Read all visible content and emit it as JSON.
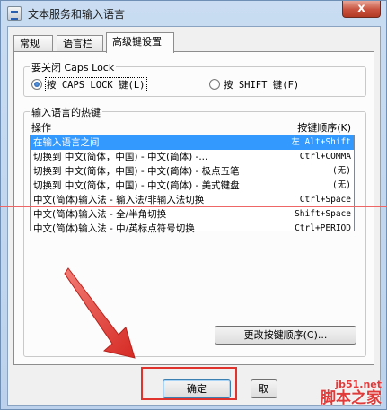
{
  "window": {
    "title": "文本服务和输入语言",
    "close_glyph": "x"
  },
  "tabs": [
    {
      "label": "常规",
      "active": false
    },
    {
      "label": "语言栏",
      "active": false
    },
    {
      "label": "高级键设置",
      "active": true
    }
  ],
  "caps_lock": {
    "group_label": "要关闭 Caps Lock",
    "options": [
      {
        "label": "按 CAPS LOCK 键(L)",
        "checked": true
      },
      {
        "label": "按 SHIFT 键(F)",
        "checked": false
      }
    ]
  },
  "hotkeys": {
    "group_label": "输入语言的热键",
    "col_action": "操作",
    "col_keys": "按键顺序(K)",
    "rows": [
      {
        "action": "在输入语言之间",
        "keys": "左 Alt+Shift",
        "selected": true
      },
      {
        "action": "切换到 中文(简体，中国) - 中文(简体) -...",
        "keys": "Ctrl+COMMA",
        "selected": false
      },
      {
        "action": "切换到 中文(简体，中国) - 中文(简体) - 极点五笔",
        "keys": "(无)",
        "selected": false
      },
      {
        "action": "切换到 中文(简体，中国) - 中文(简体) - 美式键盘",
        "keys": "(无)",
        "selected": false
      },
      {
        "action": "中文(简体)输入法 - 输入法/非输入法切换",
        "keys": "Ctrl+Space",
        "selected": false
      },
      {
        "action": "中文(简体)输入法 - 全/半角切换",
        "keys": "Shift+Space",
        "selected": false
      },
      {
        "action": "中文(简体)输入法 - 中/英标点符号切换",
        "keys": "Ctrl+PERIOD",
        "selected": false
      }
    ],
    "change_button": "更改按键顺序(C)..."
  },
  "footer": {
    "ok_button": "确定",
    "cancel_button": "取"
  },
  "watermark": {
    "url": "jb51.net",
    "name": "脚本之家"
  },
  "colors": {
    "selection": "#3399ff",
    "annotation_red": "#e0332e"
  }
}
